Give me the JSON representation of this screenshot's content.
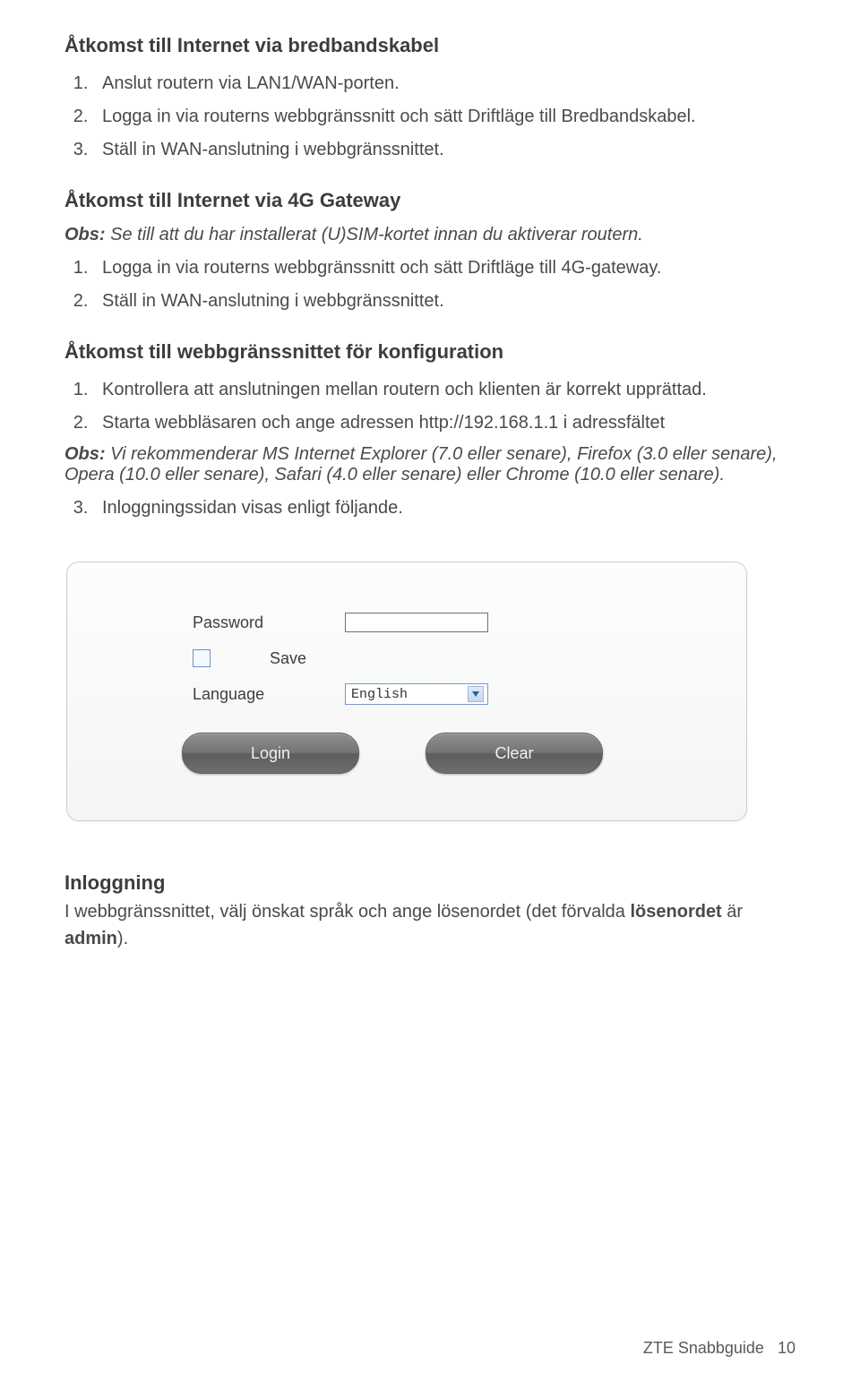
{
  "sectionA": {
    "title": "Åtkomst till Internet via bredbandskabel",
    "items": [
      "Anslut routern via LAN1/WAN-porten.",
      "Logga in via routerns webbgränssnitt och sätt Driftläge till Bredbandskabel.",
      "Ställ in WAN-anslutning i webbgränssnittet."
    ]
  },
  "sectionB": {
    "title": "Åtkomst till Internet via 4G Gateway",
    "obs_prefix": "Obs:",
    "obs_text": " Se till att du har installerat (U)SIM-kortet innan du aktiverar routern.",
    "items": [
      "Logga in via routerns webbgränssnitt och sätt Driftläge till 4G-gateway.",
      "Ställ in WAN-anslutning i webbgränssnittet."
    ]
  },
  "sectionC": {
    "title": "Åtkomst till webbgränssnittet för konfiguration",
    "items_pre": [
      "Kontrollera att anslutningen mellan routern och klienten är korrekt upprättad.",
      " Starta webbläsaren och ange adressen http://192.168.1.1 i adressfältet"
    ],
    "obs_prefix": "Obs:",
    "obs_text": " Vi rekommenderar MS Internet Explorer (7.0 eller senare), Firefox (3.0 eller senare), Opera (10.0 eller senare), Safari (4.0 eller senare) eller Chrome (10.0 eller senare).",
    "item_post": "Inloggningssidan visas enligt följande."
  },
  "login": {
    "password_label": "Password",
    "password_value": "",
    "save_label": "Save",
    "language_label": "Language",
    "language_value": "English",
    "login_btn": "Login",
    "clear_btn": "Clear"
  },
  "sectionD": {
    "title": "Inloggning",
    "text_before": "I webbgränssnittet, välj önskat språk och ange lösenordet (det förvalda ",
    "bold1": "lösenordet",
    "mid": " är ",
    "bold2": "admin",
    "after": ")."
  },
  "footer": {
    "label": "ZTE Snabbguide",
    "page": "10"
  }
}
